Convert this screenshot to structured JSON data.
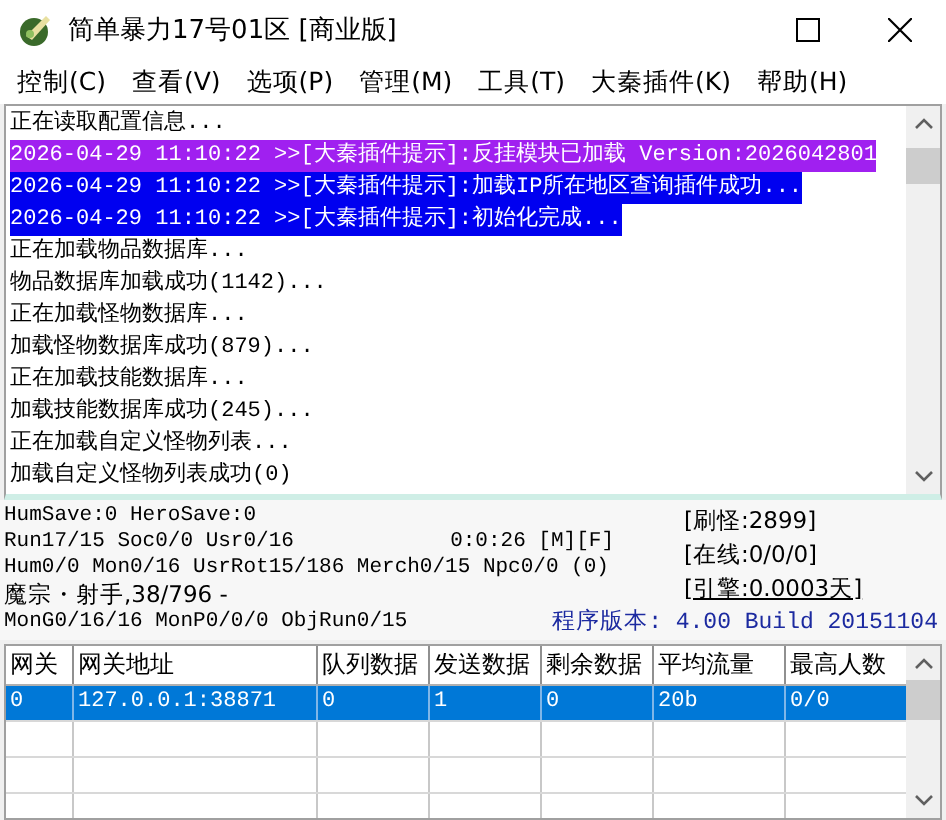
{
  "window": {
    "title": "简单暴力17号01区 [商业版]"
  },
  "menu": [
    "控制(C)",
    "查看(V)",
    "选项(P)",
    "管理(M)",
    "工具(T)",
    "大秦插件(K)",
    "帮助(H)"
  ],
  "log": [
    {
      "kind": "plain",
      "text": "正在读取配置信息..."
    },
    {
      "kind": "highlight",
      "color": "#a020f0",
      "text": "2026-04-29 11:10:22 >>[大秦插件提示]:反挂模块已加载 Version:2026042801"
    },
    {
      "kind": "highlight",
      "color": "#0000f0",
      "text": "2026-04-29 11:10:22 >>[大秦插件提示]:加载IP所在地区查询插件成功..."
    },
    {
      "kind": "highlight",
      "color": "#0000f0",
      "text": "2026-04-29 11:10:22 >>[大秦插件提示]:初始化完成..."
    },
    {
      "kind": "plain",
      "text": "正在加载物品数据库..."
    },
    {
      "kind": "plain",
      "text": "物品数据库加载成功(1142)..."
    },
    {
      "kind": "plain",
      "text": "正在加载怪物数据库..."
    },
    {
      "kind": "plain",
      "text": "加载怪物数据库成功(879)..."
    },
    {
      "kind": "plain",
      "text": "正在加载技能数据库..."
    },
    {
      "kind": "plain",
      "text": "加载技能数据库成功(245)..."
    },
    {
      "kind": "plain",
      "text": "正在加载自定义怪物列表..."
    },
    {
      "kind": "plain",
      "text": "加载自定义怪物列表成功(0)"
    }
  ],
  "status": {
    "lines": [
      "HumSave:0 HeroSave:0",
      "Run17/15 Soc0/0 Usr0/16",
      "Hum0/0 Mon0/16 UsrRot15/186 Merch0/15 Npc0/0 (0)",
      "魔宗・射手,38/796 -",
      "MonG0/16/16 MonP0/0/0 ObjRun0/15"
    ],
    "timer": "0:0:26 [M][F]",
    "counters": [
      "[刷怪:2899]",
      "[在线:0/0/0]"
    ],
    "engine": "[引擎:0.0003天]",
    "version": "程序版本: 4.00 Build 20151104"
  },
  "table": {
    "columns": [
      "网关",
      "网关地址",
      "队列数据",
      "发送数据",
      "剩余数据",
      "平均流量",
      "最高人数"
    ],
    "rows": [
      {
        "selected": true,
        "cells": [
          "0",
          "127.0.0.1:38871",
          "0",
          "1",
          "0",
          "20b",
          "0/0"
        ]
      }
    ]
  }
}
